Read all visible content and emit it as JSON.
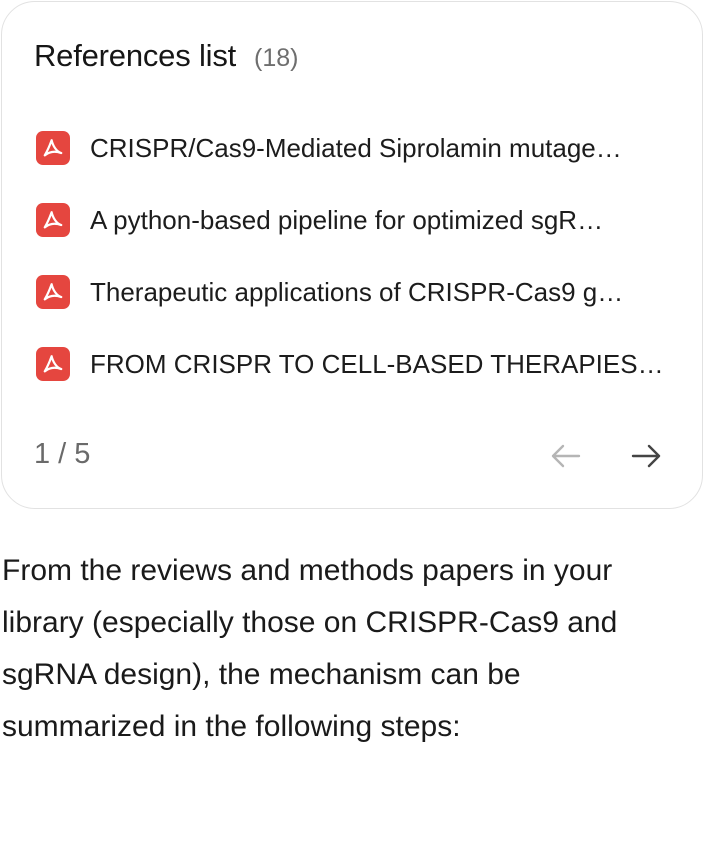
{
  "references": {
    "title": "References list",
    "count": "(18)",
    "items": [
      {
        "label": "CRISPR/Cas9-Mediated Siprolamin mutage…",
        "icon": "pdf-icon"
      },
      {
        "label": "A python-based pipeline for optimized sgR…",
        "icon": "pdf-icon"
      },
      {
        "label": "Therapeutic applications of CRISPR-Cas9 g…",
        "icon": "pdf-icon"
      },
      {
        "label": "FROM CRISPR TO CELL-BASED THERAPIES…",
        "icon": "pdf-icon"
      }
    ],
    "pagination": "1 / 5",
    "prev_icon": "arrow-left-icon",
    "next_icon": "arrow-right-icon"
  },
  "message": {
    "text": "From the reviews and methods papers in your library (especially those on CRISPR-Cas9 and sgRNA design), the mechanism can be summarized in the following steps:"
  },
  "colors": {
    "pdf_accent": "#e5463f",
    "prev_disabled": "#b5b5b5",
    "next_active": "#444444"
  }
}
